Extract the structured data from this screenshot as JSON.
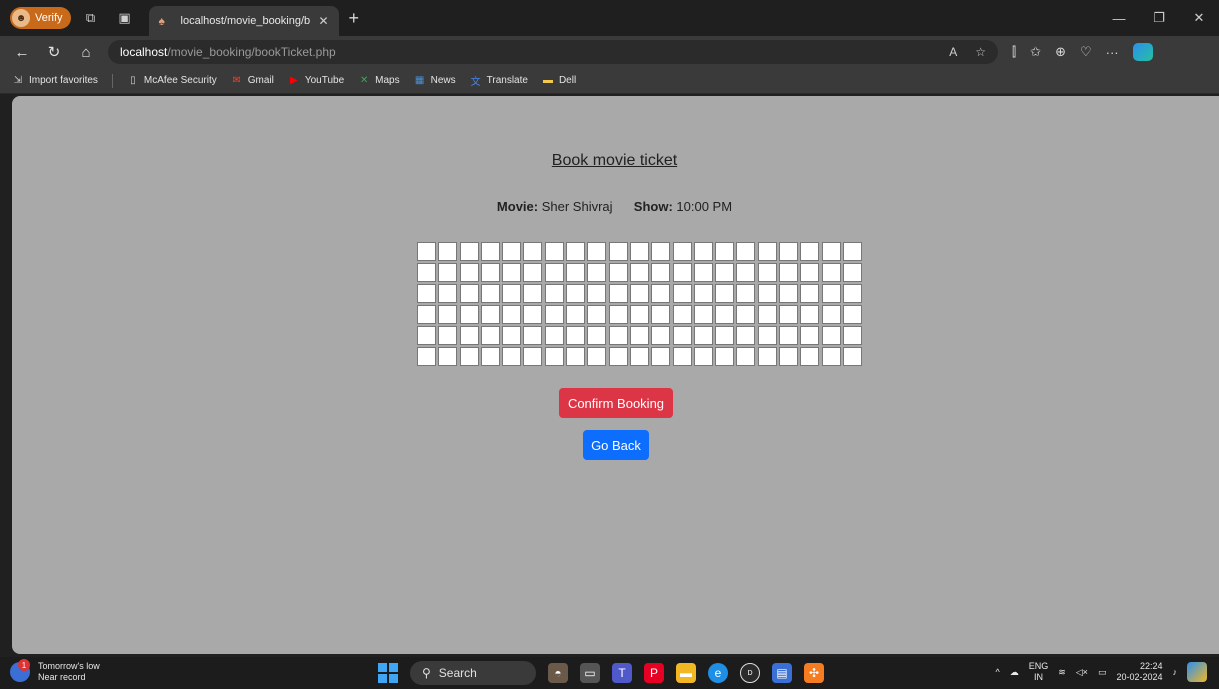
{
  "browser": {
    "profile_label": "Verify",
    "tab_title": "localhost/movie_booking/bookTi",
    "url_host": "localhost",
    "url_path": "/movie_booking/bookTicket.php"
  },
  "favorites": [
    {
      "label": "Import favorites",
      "icon": "import-icon",
      "color": "#cfcfcf"
    },
    {
      "label": "McAfee Security",
      "icon": "page-icon",
      "color": "#cfcfcf"
    },
    {
      "label": "Gmail",
      "icon": "gmail-icon",
      "color": "#ea4335"
    },
    {
      "label": "YouTube",
      "icon": "youtube-icon",
      "color": "#ff0000"
    },
    {
      "label": "Maps",
      "icon": "maps-icon",
      "color": "#34a853"
    },
    {
      "label": "News",
      "icon": "news-icon",
      "color": "#4a90d9"
    },
    {
      "label": "Translate",
      "icon": "translate-icon",
      "color": "#4285f4"
    },
    {
      "label": "Dell",
      "icon": "folder-icon",
      "color": "#f2c94c"
    }
  ],
  "page": {
    "heading": "Book movie ticket",
    "movie_label": "Movie:",
    "movie_value": "Sher Shivraj",
    "show_label": "Show:",
    "show_value": "10:00 PM",
    "seat_rows": 6,
    "seat_cols": 21,
    "confirm_label": "Confirm Booking",
    "back_label": "Go Back",
    "colors": {
      "confirm": "#dc3545",
      "back": "#0d6efd",
      "page_bg": "#a9a9a9"
    }
  },
  "taskbar": {
    "weather_line1": "Tomorrow's low",
    "weather_line2": "Near record",
    "weather_badge": "1",
    "search_label": "Search",
    "lang_line1": "ENG",
    "lang_line2": "IN",
    "time": "22:24",
    "date": "20-02-2024"
  }
}
